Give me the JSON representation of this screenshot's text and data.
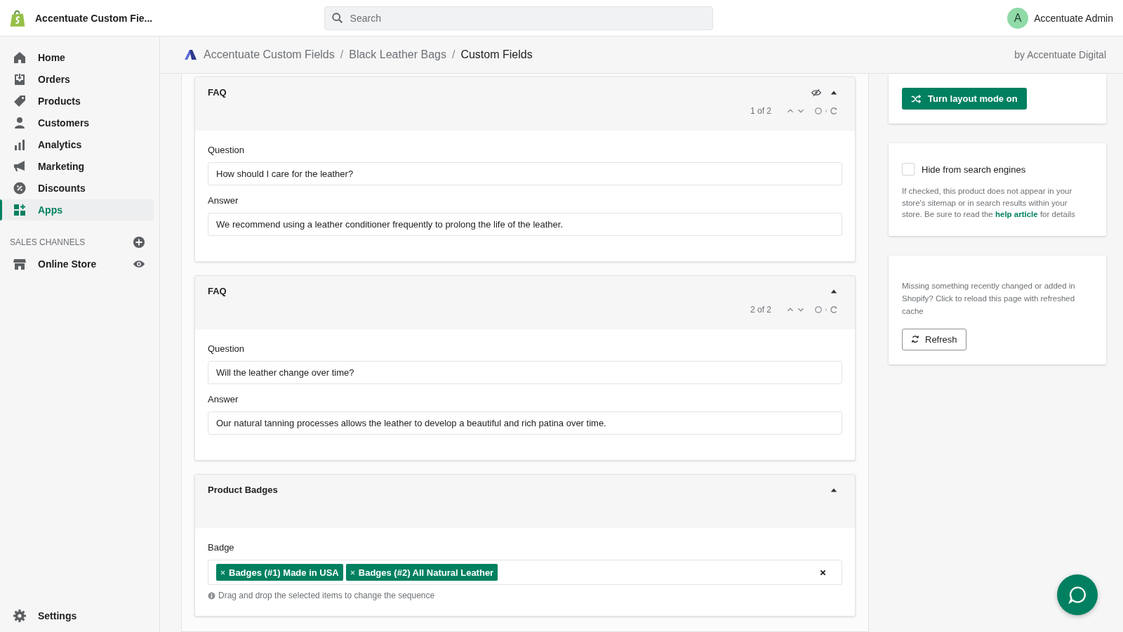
{
  "top_bar": {
    "store_name": "Accentuate Custom Fie...",
    "search": {
      "placeholder": "Search"
    },
    "user": {
      "initial": "A",
      "name": "Accentuate Admin"
    }
  },
  "sidebar": {
    "items": [
      {
        "label": "Home",
        "selected": false
      },
      {
        "label": "Orders",
        "selected": false
      },
      {
        "label": "Products",
        "selected": false
      },
      {
        "label": "Customers",
        "selected": false
      },
      {
        "label": "Analytics",
        "selected": false
      },
      {
        "label": "Marketing",
        "selected": false
      },
      {
        "label": "Discounts",
        "selected": false
      },
      {
        "label": "Apps",
        "selected": true
      }
    ],
    "sales_channels": {
      "heading": "SALES CHANNELS",
      "items": [
        {
          "label": "Online Store"
        }
      ]
    },
    "settings": {
      "label": "Settings"
    }
  },
  "breadcrumb": {
    "separator": "/",
    "items": [
      "Accentuate Custom Fields",
      "Black Leather Bags",
      "Custom Fields"
    ],
    "vendor": "by Accentuate Digital"
  },
  "sections": [
    {
      "kind": "faq",
      "title": "FAQ",
      "hidden": true,
      "counter": "1 of 2",
      "fields": [
        {
          "label": "Question",
          "value": "How should I care for the leather?"
        },
        {
          "label": "Answer",
          "value": "We recommend using a leather conditioner frequently to prolong the life of the leather."
        }
      ]
    },
    {
      "kind": "faq",
      "title": "FAQ",
      "hidden": false,
      "counter": "2 of 2",
      "fields": [
        {
          "label": "Question",
          "value": "Will the leather change over time?"
        },
        {
          "label": "Answer",
          "value": "Our natural tanning processes allows the leather to develop a beautiful and rich patina over time."
        }
      ]
    },
    {
      "kind": "badges",
      "title": "Product Badges",
      "label": "Badge",
      "tags": [
        "Badges (#1) Made in USA",
        "Badges (#2) All Natural Leather"
      ],
      "hint": "Drag and drop the selected items to change the sequence"
    }
  ],
  "side_panel": {
    "layout_button": "Turn layout mode on",
    "hide_search": {
      "label": "Hide from search engines",
      "checked": false,
      "text_before": "If checked, this product does not appear in your store's sitemap or in search results within your store. Be sure to read the",
      "link": "help article",
      "text_after": "for details"
    },
    "refresh": {
      "text": "Missing something recently changed or added in Shopify? Click to reload this page with refreshed cache",
      "button": "Refresh"
    }
  }
}
